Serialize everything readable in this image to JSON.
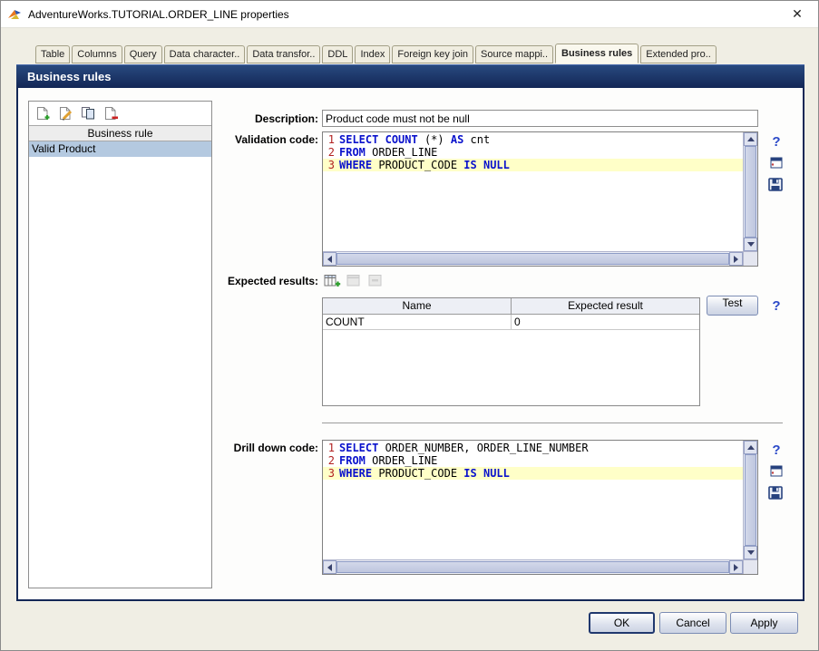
{
  "window": {
    "title": "AdventureWorks.TUTORIAL.ORDER_LINE properties",
    "close": "✕"
  },
  "tabs": {
    "items": [
      {
        "label": "Table",
        "selected": false
      },
      {
        "label": "Columns",
        "selected": false
      },
      {
        "label": "Query",
        "selected": false
      },
      {
        "label": "Data character..",
        "selected": false
      },
      {
        "label": "Data transfor..",
        "selected": false
      },
      {
        "label": "DDL",
        "selected": false
      },
      {
        "label": "Index",
        "selected": false
      },
      {
        "label": "Foreign key join",
        "selected": false
      },
      {
        "label": "Source mappi..",
        "selected": false
      },
      {
        "label": "Business rules",
        "selected": true
      },
      {
        "label": "Extended pro..",
        "selected": false
      }
    ]
  },
  "header": {
    "title": "Business rules"
  },
  "rules_list": {
    "header": "Business rule",
    "items": [
      {
        "label": "Valid Product",
        "selected": true
      }
    ],
    "toolbar_icons": [
      "add-rule",
      "edit-rule",
      "copy-rule",
      "delete-rule"
    ]
  },
  "fields": {
    "description_label": "Description:",
    "description_value": "Product code must not be null",
    "validation_label": "Validation code:",
    "expected_label": "Expected results:",
    "drilldown_label": "Drill down code:"
  },
  "validation_code": {
    "lines": [
      {
        "num": "1",
        "highlight": false,
        "tokens": [
          {
            "t": "SELECT",
            "c": "kw"
          },
          {
            "t": " "
          },
          {
            "t": "COUNT",
            "c": "kw"
          },
          {
            "t": " (*) "
          },
          {
            "t": "AS",
            "c": "kw"
          },
          {
            "t": " cnt"
          }
        ]
      },
      {
        "num": "2",
        "highlight": false,
        "tokens": [
          {
            "t": "FROM",
            "c": "kw"
          },
          {
            "t": " ORDER_LINE"
          }
        ]
      },
      {
        "num": "3",
        "highlight": true,
        "tokens": [
          {
            "t": "WHERE",
            "c": "kw"
          },
          {
            "t": " PRODUCT_CODE "
          },
          {
            "t": "IS",
            "c": "kw"
          },
          {
            "t": " "
          },
          {
            "t": "NULL",
            "c": "kw"
          }
        ]
      }
    ]
  },
  "drilldown_code": {
    "lines": [
      {
        "num": "1",
        "highlight": false,
        "tokens": [
          {
            "t": "SELECT",
            "c": "kw"
          },
          {
            "t": " ORDER_NUMBER, ORDER_LINE_NUMBER"
          }
        ]
      },
      {
        "num": "2",
        "highlight": false,
        "tokens": [
          {
            "t": "FROM",
            "c": "kw"
          },
          {
            "t": " ORDER_LINE"
          }
        ]
      },
      {
        "num": "3",
        "highlight": true,
        "tokens": [
          {
            "t": "WHERE",
            "c": "kw"
          },
          {
            "t": " PRODUCT_CODE "
          },
          {
            "t": "IS",
            "c": "kw"
          },
          {
            "t": " "
          },
          {
            "t": "NULL",
            "c": "kw"
          }
        ]
      }
    ]
  },
  "expected_toolbar": {
    "icons": [
      "add-expected-result",
      "edit-expected-result-disabled",
      "delete-expected-result-disabled"
    ]
  },
  "results_table": {
    "columns": [
      "Name",
      "Expected result"
    ],
    "rows": [
      [
        "COUNT",
        "0"
      ]
    ]
  },
  "side_icons": [
    "help",
    "open-editor",
    "save"
  ],
  "buttons": {
    "test": "Test",
    "ok": "OK",
    "cancel": "Cancel",
    "apply": "Apply"
  },
  "colors": {
    "band_navy": "#132756",
    "selection_blue": "#b4c9e0",
    "line_highlight": "#ffffc8",
    "sql_keyword": "#0a12cc",
    "line_number": "#b22222"
  }
}
